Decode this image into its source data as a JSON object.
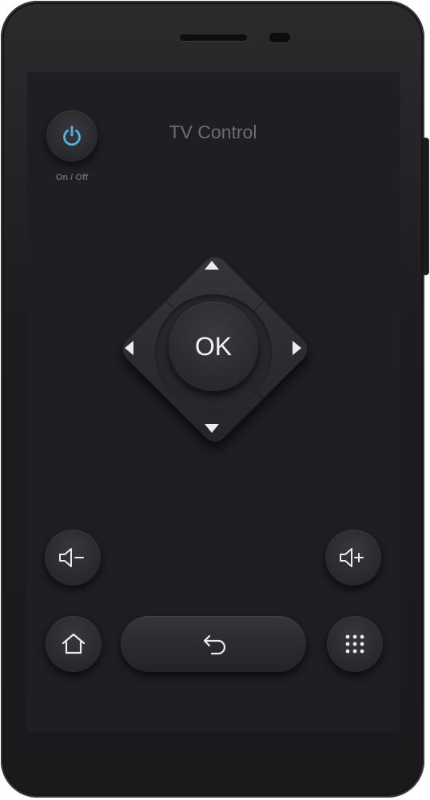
{
  "header": {
    "title": "TV Control"
  },
  "power": {
    "label": "On / Off",
    "icon": "power-icon",
    "accent_color": "#4fb3e6"
  },
  "dpad": {
    "center_label": "OK",
    "arrows": [
      "up-arrow-icon",
      "right-arrow-icon",
      "down-arrow-icon",
      "left-arrow-icon"
    ]
  },
  "volume": {
    "down_icon": "volume-down-icon",
    "up_icon": "volume-up-icon"
  },
  "bottom_bar": {
    "home_icon": "home-icon",
    "back_icon": "back-icon",
    "menu_icon": "apps-grid-icon"
  },
  "colors": {
    "screen_bg": "#1f1e22",
    "button_bg": "#2c2b30",
    "text_muted": "#6d6c72",
    "icon_light": "#ececec"
  }
}
